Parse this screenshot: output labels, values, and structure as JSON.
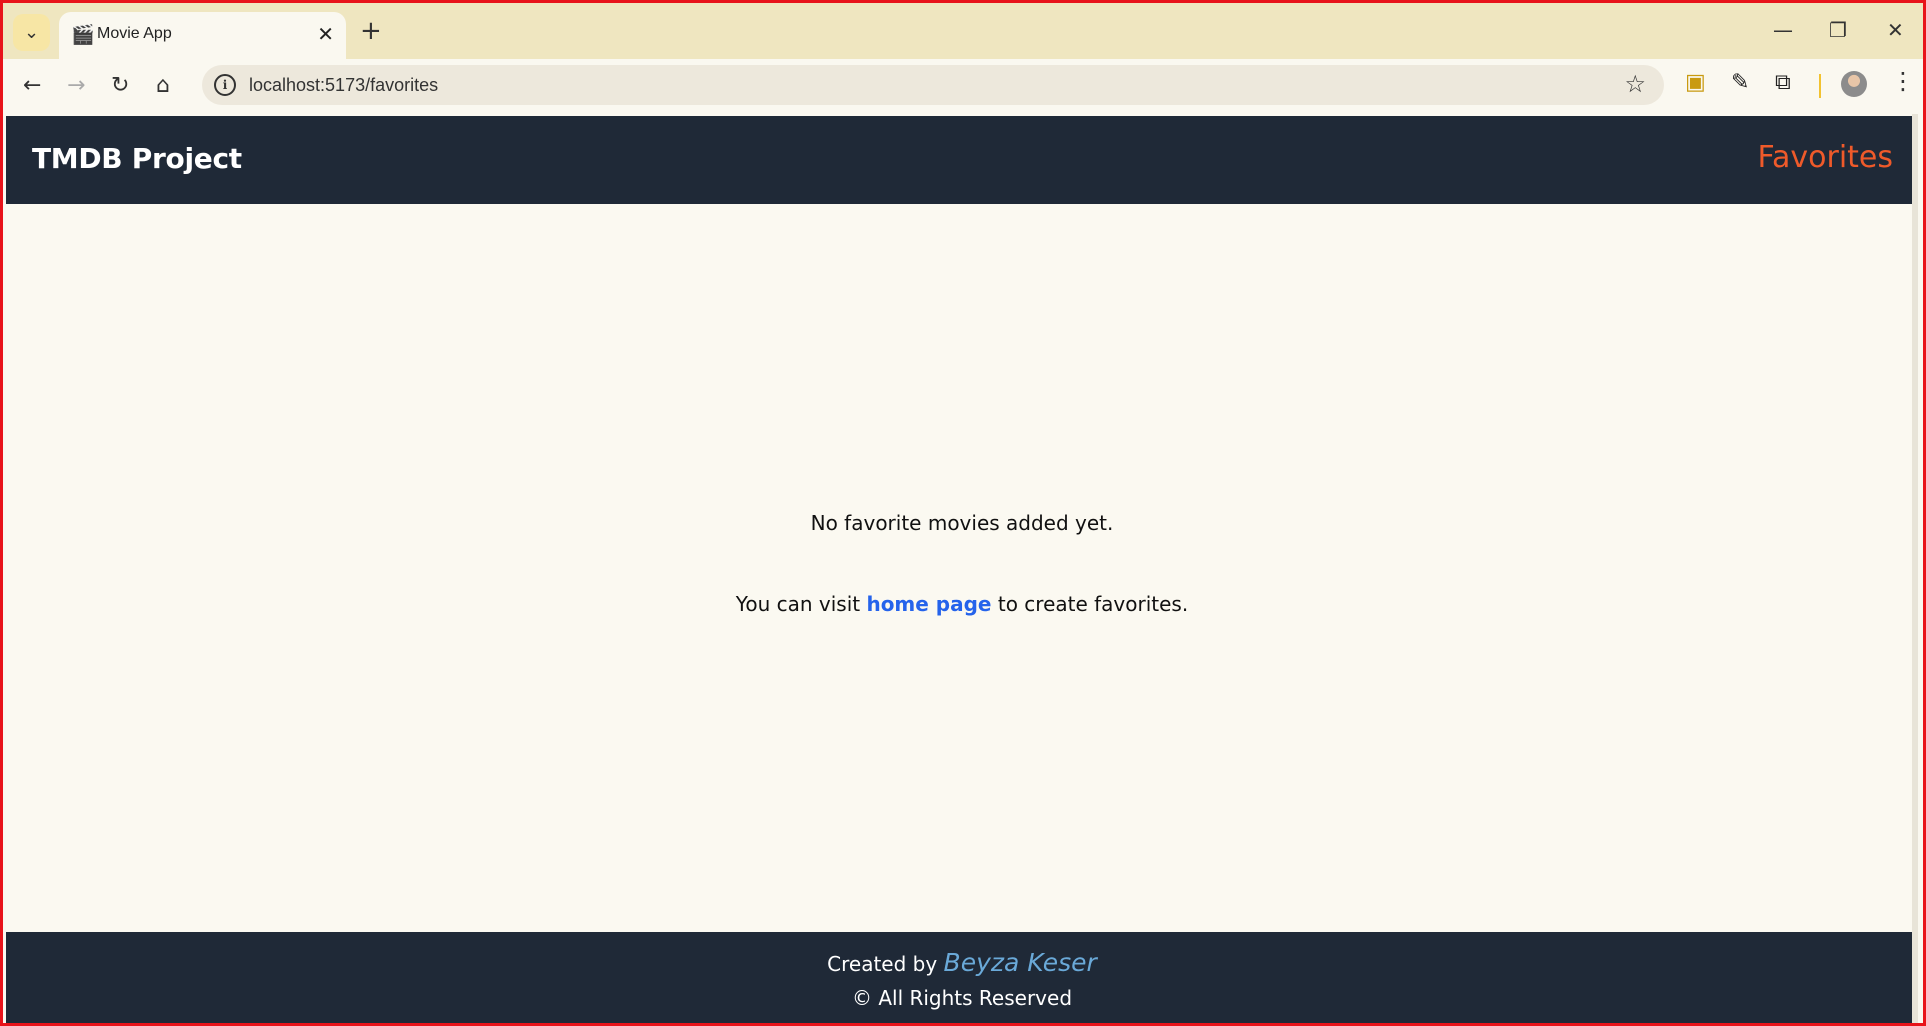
{
  "browser": {
    "tab_title": "Movie App",
    "url": "localhost:5173/favorites",
    "icons": {
      "tab_search": "chevron-down-icon",
      "favicon": "clapperboard-icon",
      "tab_close": "close-icon",
      "new_tab": "plus-icon",
      "minimize": "minimize-icon",
      "restore": "restore-icon",
      "close_window": "close-icon",
      "back": "back-arrow-icon",
      "forward": "forward-arrow-icon",
      "reload": "reload-icon",
      "home": "home-icon",
      "site_info": "info-icon",
      "bookmark": "star-icon",
      "extensions": [
        "folder-extension-icon",
        "eyedropper-icon",
        "puzzle-icon"
      ],
      "menu": "kebab-menu-icon"
    }
  },
  "header": {
    "brand": "TMDB Project",
    "nav_favorites": "Favorites"
  },
  "main": {
    "empty_message": "No favorite movies added yet.",
    "hint_prefix": "You can visit ",
    "hint_link": "home page",
    "hint_suffix": " to create favorites."
  },
  "footer": {
    "created_by": "Created by ",
    "author": "Beyza Keser",
    "rights": "© All Rights Reserved"
  },
  "colors": {
    "header_bg": "#1f2937",
    "accent": "#ef5a2a",
    "link": "#2563eb",
    "author": "#6aa9d8",
    "page_bg": "#fbf9f1"
  }
}
